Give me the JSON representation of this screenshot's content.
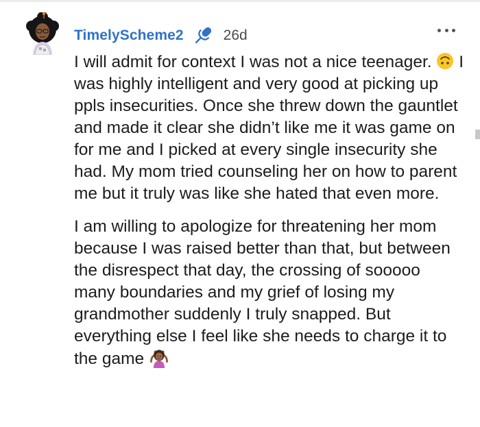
{
  "comment": {
    "username": "TimelyScheme2",
    "age": "26d",
    "paragraphs": [
      {
        "before_emoji": "I will admit for context I was not a nice teenager.",
        "emoji": "upside-down-face",
        "after_emoji": " I was highly intelligent and very good at picking up ppls insecurities. Once she threw down the gauntlet and made it clear she didn’t like me it was game on for me and I picked at every single insecurity she had. My mom tried counseling her on how to parent me but it truly was like she hated that even more."
      },
      {
        "before_emoji": "I am willing to apologize for threatening her mom because I was raised better than that, but between the disrespect that day, the crossing of sooooo many boundaries and my grief of losing my grandmother suddenly I truly snapped. But everything else I feel like she needs to charge it to the game",
        "emoji": "woman-shrugging"
      }
    ]
  },
  "icons": {
    "avatar": "avatar-icon",
    "microphone": "microphone-icon",
    "more": "more-options-icon"
  },
  "colors": {
    "username": "#2f73c6",
    "text": "#1c1c1c",
    "meta": "#4a4a4a"
  }
}
